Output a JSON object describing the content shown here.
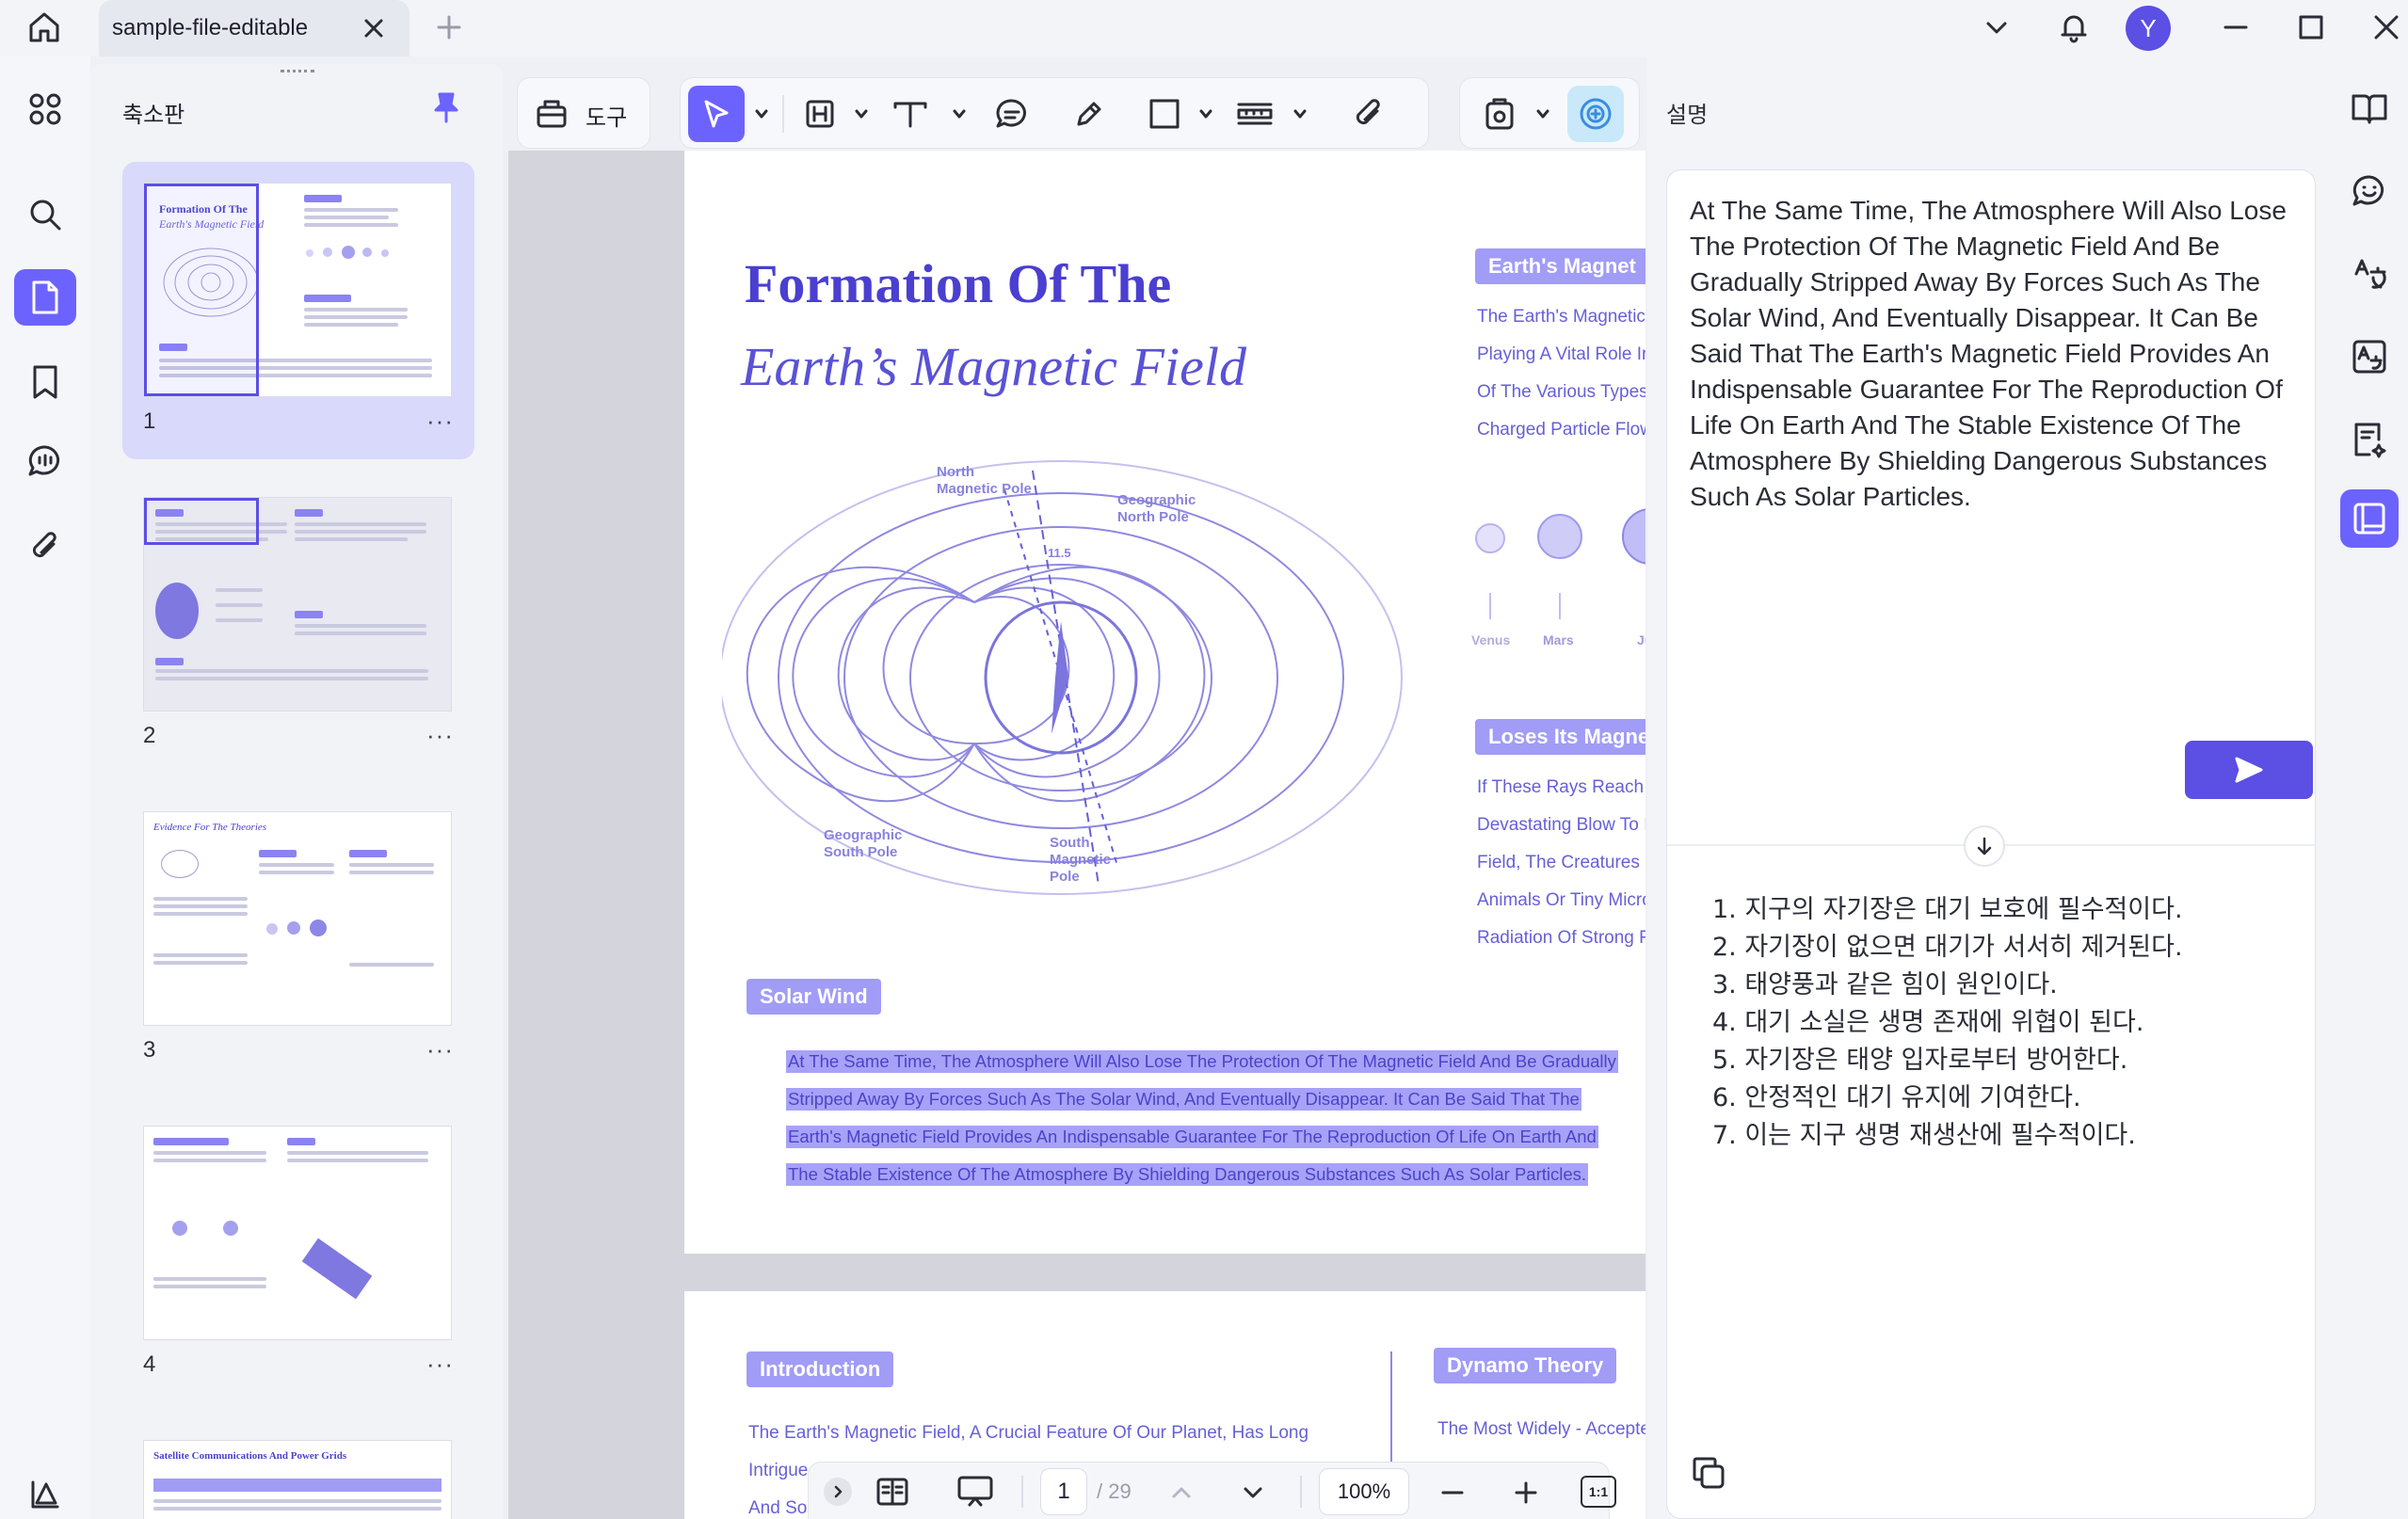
{
  "window": {
    "tab_title": "sample-file-editable",
    "avatar_letter": "Y"
  },
  "thumbnails": {
    "title": "축소판",
    "pages": [
      {
        "number": "1",
        "more": "···",
        "heading": "Formation Of The",
        "subheading": "Earth's Magnetic Field"
      },
      {
        "number": "2",
        "more": "···"
      },
      {
        "number": "3",
        "more": "···",
        "heading": "Evidence For The Theories"
      },
      {
        "number": "4",
        "more": "···"
      },
      {
        "heading": "Satellite Communications And Power Grids"
      }
    ]
  },
  "toolbar": {
    "tools_label": "도구"
  },
  "document": {
    "title_line1": "Formation Of The",
    "title_line2": "Earth’s Magnetic Field",
    "diagram": {
      "north_magnetic_pole": "North\nMagnetic Pole",
      "geographic_north_pole": "Geographic\nNorth Pole",
      "angle": "11.5",
      "geographic_south_pole": "Geographic\nSouth Pole",
      "south_magnetic_pole": "South\nMagnetic\nPole"
    },
    "side_box1_title": "Earth's Magnet",
    "side_box1_lines": [
      "The Earth's Magnetic",
      "Playing A Vital Role Ir",
      "Of The Various Types",
      "Charged Particle Flow"
    ],
    "planets": [
      "Venus",
      "Mars",
      "Ju"
    ],
    "side_box2_title": "Loses Its Magne",
    "side_box2_lines": [
      "If These Rays Reach",
      "Devastating Blow To I",
      "Field, The Creatures C",
      "Animals Or Tiny Micro",
      "Radiation Of Strong R"
    ],
    "solar_wind_label": "Solar Wind",
    "highlighted_lines": [
      "At The Same Time, The Atmosphere Will Also Lose The Protection Of The Magnetic Field And Be Gradually",
      "Stripped Away By Forces Such As The Solar Wind, And Eventually Disappear. It Can Be Said That The",
      "Earth's Magnetic Field Provides An Indispensable Guarantee For The Reproduction Of Life On Earth And",
      "The Stable Existence Of The Atmosphere By Shielding Dangerous Substances Such As Solar Particles."
    ],
    "page2_intro_label": "Introduction",
    "page2_intro_lines": [
      "The Earth's Magnetic Field, A Crucial Feature Of Our Planet, Has Long",
      "Intrigue",
      "And Sol"
    ],
    "page2_dynamo_label": "Dynamo Theory",
    "page2_dynamo_line": "The Most Widely - Accepted"
  },
  "bottom_nav": {
    "current_page": "1",
    "total_pages": "/ 29",
    "zoom": "100%",
    "fit_label": "1:1"
  },
  "right_panel": {
    "title": "설명",
    "input_text": "At The Same Time, The Atmosphere Will Also Lose The Protection Of The Magnetic Field And Be Gradually Stripped Away By Forces Such As The Solar Wind, And Eventually Disappear. It Can Be Said That The Earth's Magnetic Field Provides An Indispensable Guarantee For The Reproduction Of Life On Earth And The Stable Existence Of The Atmosphere By Shielding Dangerous Substances Such As Solar Particles.",
    "result_items": [
      "1. 지구의 자기장은 대기 보호에 필수적이다.",
      "2. 자기장이 없으면 대기가 서서히 제거된다.",
      "3. 태양풍과 같은 힘이 원인이다.",
      "4. 대기 소실은 생명 존재에 위협이 된다.",
      "5. 자기장은 태양 입자로부터 방어한다.",
      "6. 안정적인 대기 유지에 기여한다.",
      "7. 이는 지구 생명 재생산에 필수적이다."
    ]
  },
  "colors": {
    "accent": "#6c63ff",
    "send_button": "#5b4fe4",
    "doc_purple": "#5a52d6",
    "highlight": "#a7a2f7"
  }
}
